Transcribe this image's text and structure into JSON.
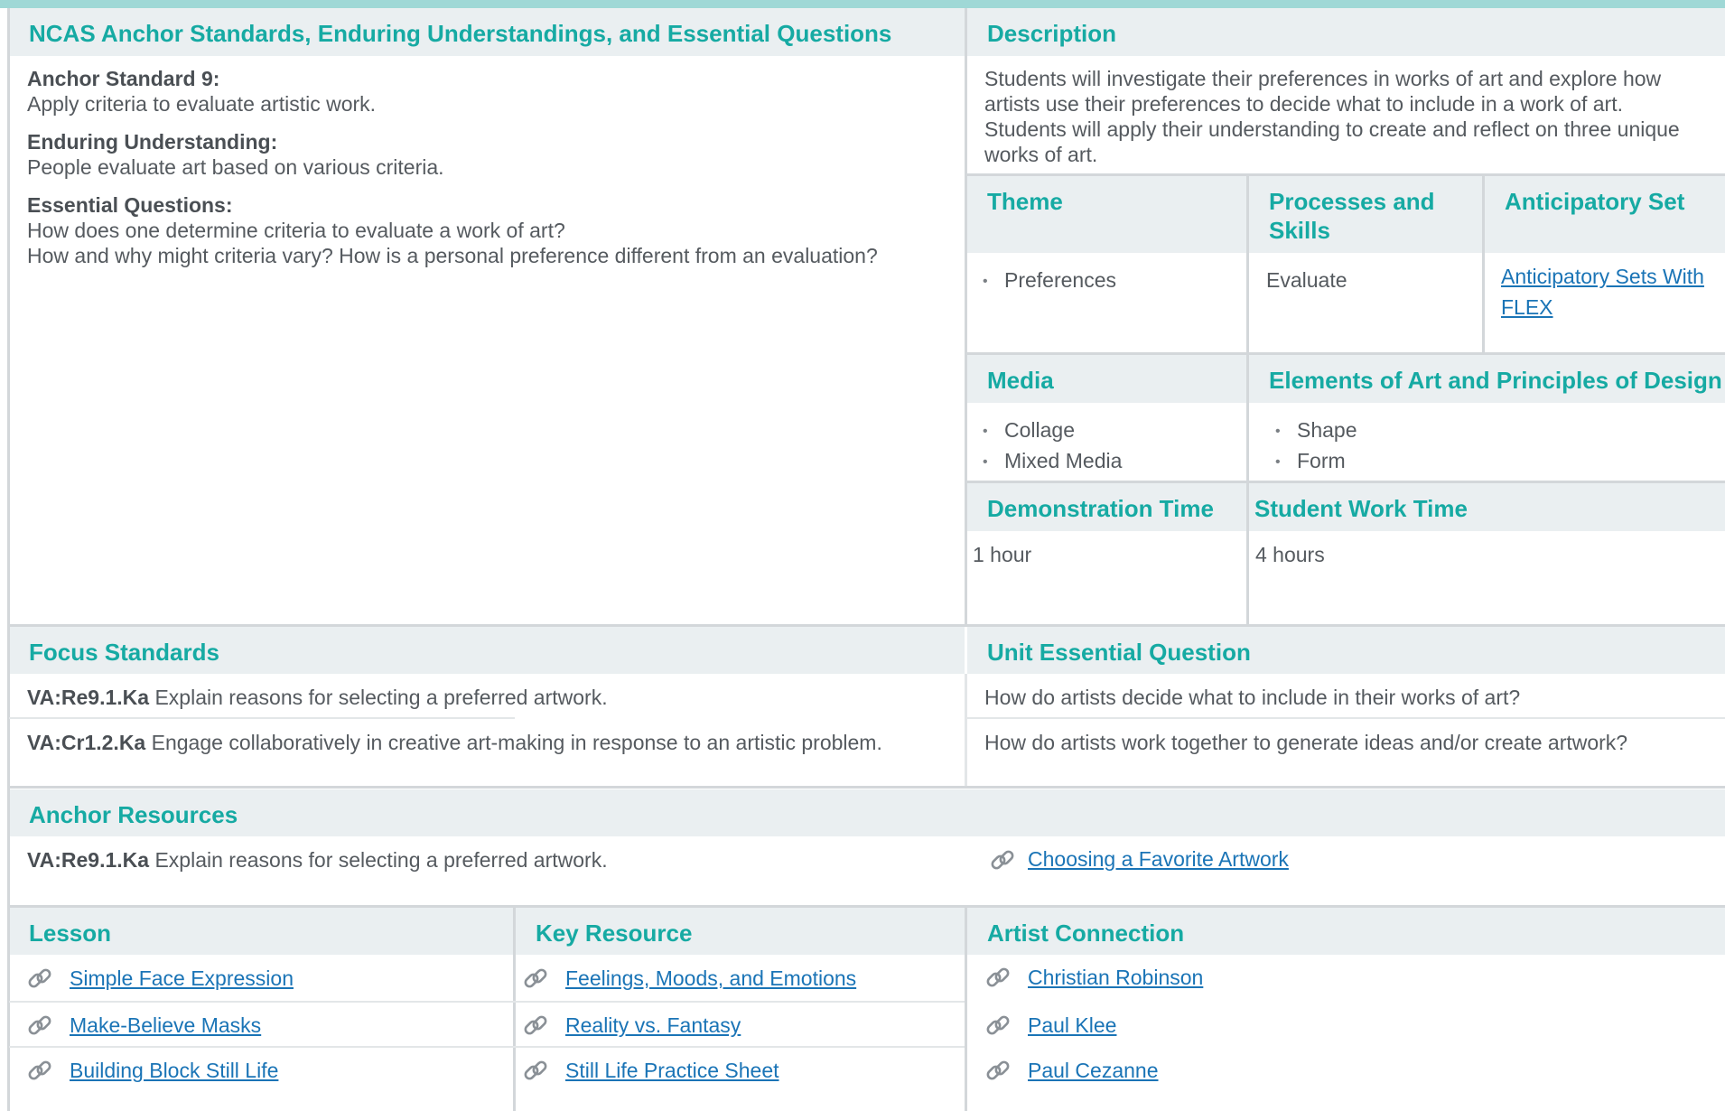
{
  "ncas": {
    "header": "NCAS Anchor Standards, Enduring Understandings, and Essential Questions",
    "anchor_label": "Anchor Standard 9:",
    "anchor_text": "Apply criteria to evaluate artistic work.",
    "enduring_label": "Enduring Understanding:",
    "enduring_text": "People evaluate art based on various criteria.",
    "essential_label": "Essential Questions:",
    "essential_q1": "How does one determine criteria to evaluate a work of art?",
    "essential_q2": "How and why might criteria vary? How is a personal preference different from an evaluation?"
  },
  "description": {
    "header": "Description",
    "lines": [
      "Students will investigate their preferences in works of art and explore how",
      "artists use their preferences to decide what to include in a work of art.",
      "Students will apply their understanding to create and reflect on three unique",
      "works of art."
    ]
  },
  "theme": {
    "header": "Theme",
    "items": [
      "Preferences"
    ]
  },
  "processes": {
    "header_line1": "Processes and",
    "header_line2": "Skills",
    "value": "Evaluate"
  },
  "anticipatory": {
    "header": "Anticipatory Set",
    "link_line1": "Anticipatory Sets With",
    "link_line2": "FLEX"
  },
  "media": {
    "header": "Media",
    "items": [
      "Collage",
      "Mixed Media"
    ]
  },
  "elements": {
    "header": "Elements of Art and Principles of Design",
    "items": [
      "Shape",
      "Form"
    ]
  },
  "demo_time": {
    "header": "Demonstration Time",
    "value": "1 hour"
  },
  "work_time": {
    "header": "Student Work Time",
    "value": "4 hours"
  },
  "focus": {
    "header": "Focus Standards",
    "rows": [
      {
        "code": "VA:Re9.1.Ka",
        "text": "Explain reasons for selecting a preferred artwork."
      },
      {
        "code": "VA:Cr1.2.Ka",
        "text": "Engage collaboratively in creative art-making in response to an artistic problem."
      }
    ]
  },
  "unit_question": {
    "header": "Unit Essential Question",
    "rows": [
      "How do artists decide what to include in their works of art?",
      "How do artists work together to generate ideas and/or create artwork?"
    ]
  },
  "anchor_resources": {
    "header": "Anchor Resources",
    "code": "VA:Re9.1.Ka",
    "text": "Explain reasons for selecting a preferred artwork.",
    "link": "Choosing a Favorite Artwork"
  },
  "lesson": {
    "header": "Lesson",
    "links": [
      "Simple Face Expression",
      "Make-Believe Masks",
      "Building Block Still Life"
    ]
  },
  "key_resource": {
    "header": "Key Resource",
    "links": [
      "Feelings, Moods, and Emotions",
      "Reality vs. Fantasy",
      "Still Life Practice Sheet"
    ]
  },
  "artist": {
    "header": "Artist Connection",
    "links": [
      "Christian Robinson",
      "Paul Klee",
      "Paul Cezanne"
    ]
  },
  "icons": {
    "link": "link-icon"
  },
  "colors": {
    "accent": "#16aaa3",
    "header_bg": "#eaeff1",
    "link": "#1a74b6",
    "top_bar": "#9fd8d6"
  }
}
